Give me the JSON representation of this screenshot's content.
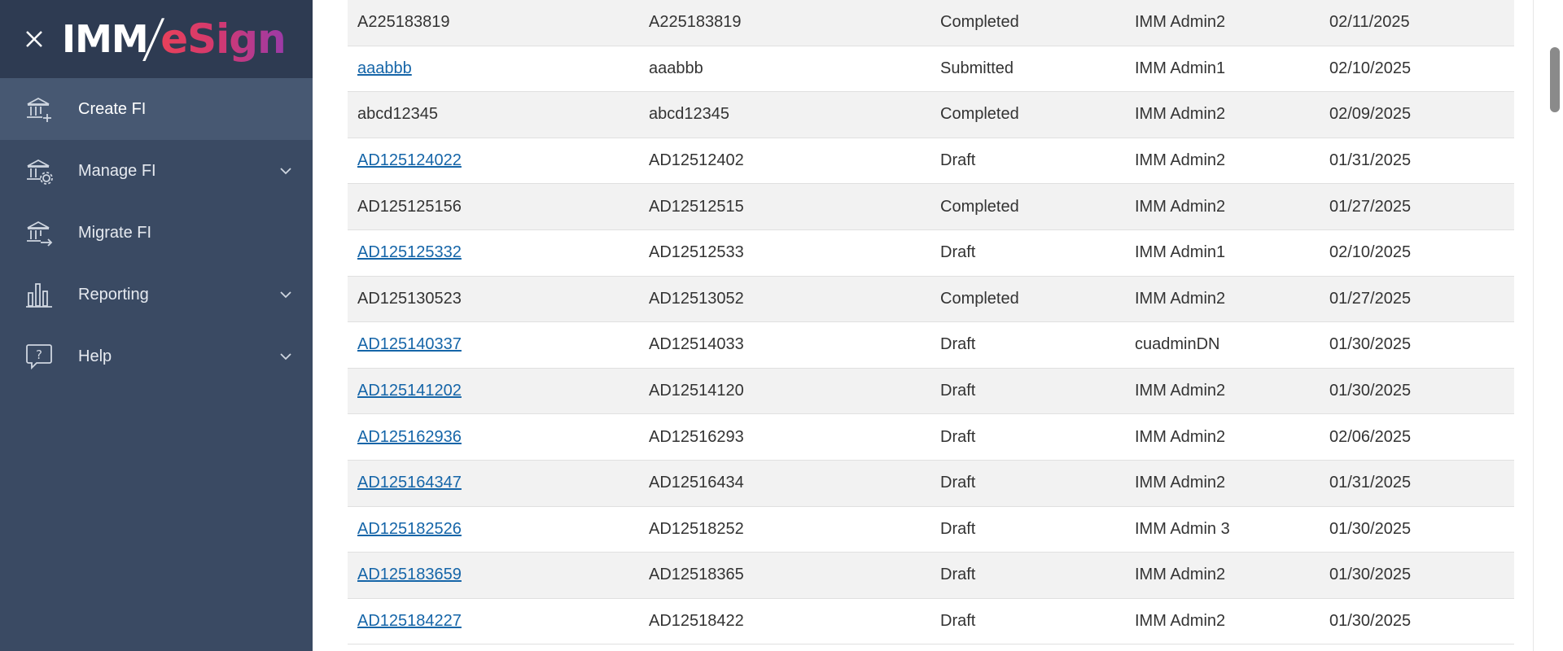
{
  "brand": {
    "name_left": "IMM",
    "name_right": "eSign"
  },
  "sidebar": {
    "items": [
      {
        "label": "Create FI",
        "icon": "bank-plus-icon",
        "active": true,
        "expandable": false
      },
      {
        "label": "Manage FI",
        "icon": "bank-gear-icon",
        "active": false,
        "expandable": true
      },
      {
        "label": "Migrate FI",
        "icon": "bank-arrow-icon",
        "active": false,
        "expandable": false
      },
      {
        "label": "Reporting",
        "icon": "bar-chart-icon",
        "active": false,
        "expandable": true
      },
      {
        "label": "Help",
        "icon": "help-bubble-icon",
        "active": false,
        "expandable": true
      }
    ]
  },
  "table": {
    "rows": [
      {
        "id": "A225183819",
        "code": "A225183819",
        "status": "Completed",
        "user": "IMM Admin2",
        "date": "02/11/2025",
        "link": false
      },
      {
        "id": "aaabbb",
        "code": "aaabbb",
        "status": "Submitted",
        "user": "IMM Admin1",
        "date": "02/10/2025",
        "link": true
      },
      {
        "id": "abcd12345",
        "code": "abcd12345",
        "status": "Completed",
        "user": "IMM Admin2",
        "date": "02/09/2025",
        "link": false
      },
      {
        "id": "AD125124022",
        "code": "AD12512402",
        "status": "Draft",
        "user": "IMM Admin2",
        "date": "01/31/2025",
        "link": true
      },
      {
        "id": "AD125125156",
        "code": "AD12512515",
        "status": "Completed",
        "user": "IMM Admin2",
        "date": "01/27/2025",
        "link": false
      },
      {
        "id": "AD125125332",
        "code": "AD12512533",
        "status": "Draft",
        "user": "IMM Admin1",
        "date": "02/10/2025",
        "link": true
      },
      {
        "id": "AD125130523",
        "code": "AD12513052",
        "status": "Completed",
        "user": "IMM Admin2",
        "date": "01/27/2025",
        "link": false
      },
      {
        "id": "AD125140337",
        "code": "AD12514033",
        "status": "Draft",
        "user": "cuadminDN",
        "date": "01/30/2025",
        "link": true
      },
      {
        "id": "AD125141202",
        "code": "AD12514120",
        "status": "Draft",
        "user": "IMM Admin2",
        "date": "01/30/2025",
        "link": true
      },
      {
        "id": "AD125162936",
        "code": "AD12516293",
        "status": "Draft",
        "user": "IMM Admin2",
        "date": "02/06/2025",
        "link": true
      },
      {
        "id": "AD125164347",
        "code": "AD12516434",
        "status": "Draft",
        "user": "IMM Admin2",
        "date": "01/31/2025",
        "link": true
      },
      {
        "id": "AD125182526",
        "code": "AD12518252",
        "status": "Draft",
        "user": "IMM Admin 3",
        "date": "01/30/2025",
        "link": true
      },
      {
        "id": "AD125183659",
        "code": "AD12518365",
        "status": "Draft",
        "user": "IMM Admin2",
        "date": "01/30/2025",
        "link": true
      },
      {
        "id": "AD125184227",
        "code": "AD12518422",
        "status": "Draft",
        "user": "IMM Admin2",
        "date": "01/30/2025",
        "link": true
      }
    ]
  },
  "colors": {
    "sidebar_bg": "#3a4a63",
    "brand_bg": "#2e3b52",
    "active_item_bg": "#475872",
    "link": "#1565a8",
    "row_alt": "#f2f2f2"
  }
}
